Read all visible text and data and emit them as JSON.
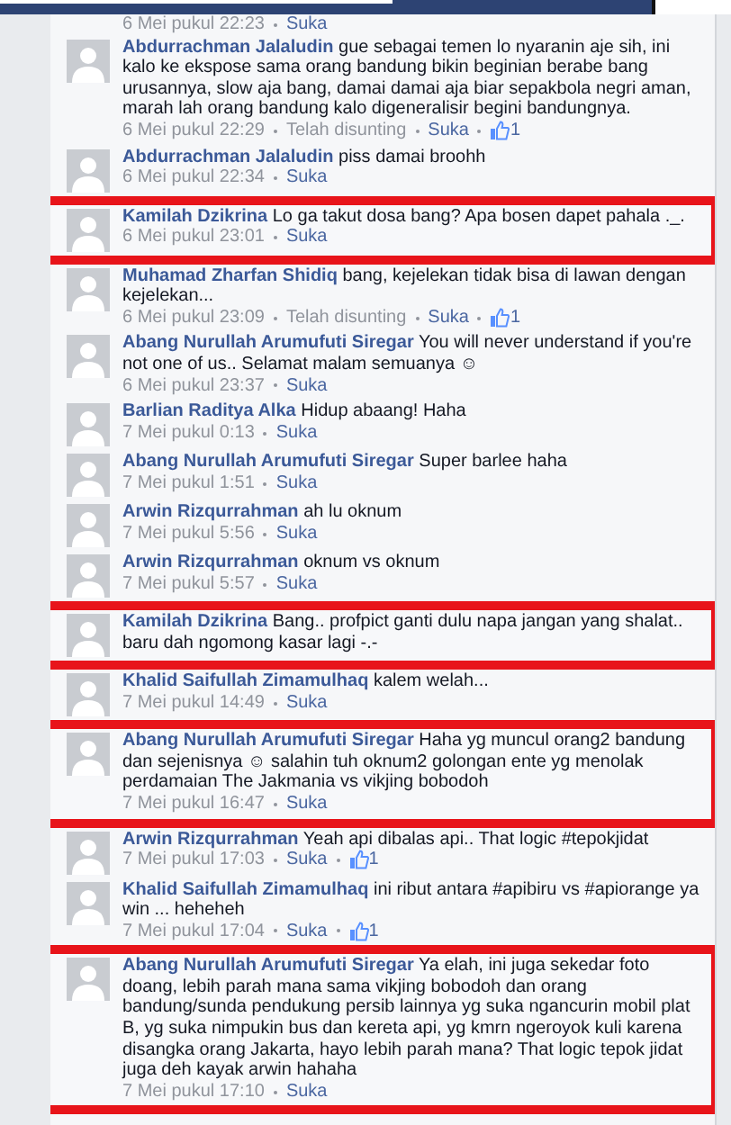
{
  "partial_meta": {
    "time": "6 Mei pukul 22:23",
    "action": "Suka"
  },
  "comments": [
    {
      "name": "Abdurrachman Jalaludin",
      "text": "gue sebagai temen lo nyaranin aje sih, ini kalo ke ekspose sama orang bandung bikin beginian berabe bang urusannya, slow aja bang, damai damai aja biar sepakbola negri aman, marah lah orang bandung kalo digeneralisir begini bandungnya.",
      "time": "6 Mei pukul 22:29",
      "edited": "Telah disunting",
      "action": "Suka",
      "likes": "1",
      "highlighted": false
    },
    {
      "name": "Abdurrachman Jalaludin",
      "text": "piss damai broohh",
      "time": "6 Mei pukul 22:34",
      "action": "Suka",
      "highlighted": false
    },
    {
      "name": "Kamilah Dzikrina",
      "text": "Lo ga takut dosa bang? Apa bosen dapet pahala ._.",
      "time": "6 Mei pukul 23:01",
      "action": "Suka",
      "highlighted": true
    },
    {
      "name": "Muhamad Zharfan Shidiq",
      "text": "bang, kejelekan tidak bisa di lawan dengan kejelekan...",
      "time": "6 Mei pukul 23:09",
      "edited": "Telah disunting",
      "action": "Suka",
      "likes": "1",
      "highlighted": false
    },
    {
      "name": "Abang Nurullah Arumufuti Siregar",
      "text": "You will never understand if you're not one of us.. Selamat malam semuanya ☺",
      "time": "6 Mei pukul 23:37",
      "action": "Suka",
      "highlighted": false
    },
    {
      "name": "Barlian Raditya Alka",
      "text": "Hidup abaang! Haha",
      "time": "7 Mei pukul 0:13",
      "action": "Suka",
      "highlighted": false
    },
    {
      "name": "Abang Nurullah Arumufuti Siregar",
      "text": "Super barlee haha",
      "time": "7 Mei pukul 1:51",
      "action": "Suka",
      "highlighted": false
    },
    {
      "name": "Arwin Rizqurrahman",
      "text": "ah lu oknum",
      "time": "7 Mei pukul 5:56",
      "action": "Suka",
      "highlighted": false
    },
    {
      "name": "Arwin Rizqurrahman",
      "text": "oknum vs oknum",
      "time": "7 Mei pukul 5:57",
      "action": "Suka",
      "highlighted": false
    },
    {
      "name": "Kamilah Dzikrina",
      "text": "Bang.. profpict ganti dulu napa jangan yang shalat.. baru dah ngomong kasar lagi -.-",
      "highlighted": true
    },
    {
      "name": "Khalid Saifullah Zimamulhaq",
      "text": "kalem welah...",
      "time": "7 Mei pukul 14:49",
      "action": "Suka",
      "highlighted": false
    },
    {
      "name": "Abang Nurullah Arumufuti Siregar",
      "text": "Haha yg muncul orang2 bandung dan sejenisnya ☺ salahin tuh oknum2 golongan ente yg menolak perdamaian The Jakmania vs vikjing bobodoh",
      "time": "7 Mei pukul 16:47",
      "action": "Suka",
      "highlighted": true
    },
    {
      "name": "Arwin Rizqurrahman",
      "text": "Yeah api dibalas api.. That logic #tepokjidat",
      "time": "7 Mei pukul 17:03",
      "action": "Suka",
      "likes": "1",
      "highlighted": false
    },
    {
      "name": "Khalid Saifullah Zimamulhaq",
      "text": "ini ribut antara #apibiru vs #apiorange ya win ... heheheh",
      "time": "7 Mei pukul 17:04",
      "action": "Suka",
      "likes": "1",
      "highlighted": false
    },
    {
      "name": "Abang Nurullah Arumufuti Siregar",
      "text": "Ya elah, ini juga sekedar foto doang, lebih parah mana sama vikjing bobodoh dan orang bandung/sunda pendukung persib lainnya yg suka ngancurin mobil plat B, yg suka nimpukin bus dan kereta api, yg kmrn ngeroyok kuli karena disangka orang Jakarta, hayo lebih parah mana? That logic tepok jidat juga deh kayak arwin hahaha",
      "time": "7 Mei pukul 17:10",
      "action": "Suka",
      "highlighted": true
    }
  ]
}
